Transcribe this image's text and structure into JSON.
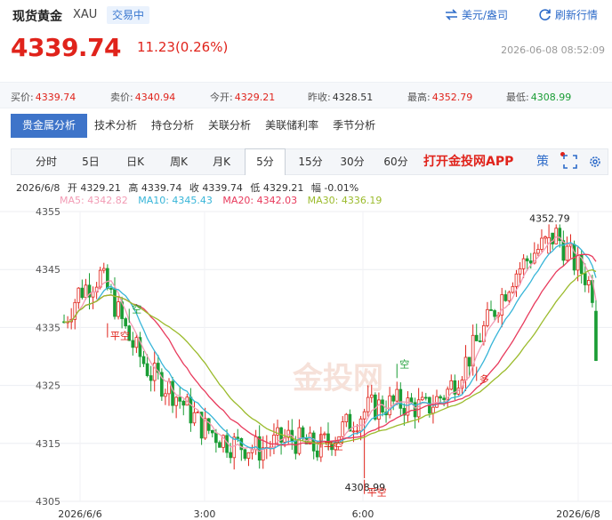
{
  "header": {
    "title": "现货黄金",
    "symbol": "XAU",
    "status": "交易中",
    "unit_link": "美元/盎司",
    "refresh_link": "刷新行情"
  },
  "quote": {
    "price": "4339.74",
    "change": "11.23(0.26%)",
    "timestamp": "2026-06-08 08:52:09"
  },
  "stats": [
    {
      "label": "买价:",
      "value": "4339.74"
    },
    {
      "label": "卖价:",
      "value": "4340.94"
    },
    {
      "label": "今开:",
      "value": "4329.21"
    },
    {
      "label": "昨收:",
      "value": "4328.51"
    },
    {
      "label": "最高:",
      "value": "4352.79"
    },
    {
      "label": "最低:",
      "value": "4308.99"
    }
  ],
  "category_tabs": [
    "贵金属分析",
    "技术分析",
    "持仓分析",
    "关联分析",
    "美联储利率",
    "季节分析"
  ],
  "periods": [
    "分时",
    "5日",
    "日K",
    "周K",
    "月K",
    "5分",
    "15分",
    "30分",
    "60分"
  ],
  "active_period": "5分",
  "app_link": "打开金投网APP",
  "tools": {
    "strategy": "策",
    "fullscreen_icon": "fullscreen-icon",
    "settings_icon": "settings-icon"
  },
  "info_row": {
    "date": "2026/6/8",
    "open": "开 4329.21",
    "high": "高 4339.74",
    "close": "收 4339.74",
    "low": "低 4329.21",
    "range": "幅 -0.01%"
  },
  "ma": [
    {
      "label": "MA5: 4342.82",
      "color": "#f29bb4"
    },
    {
      "label": "MA10: 4345.43",
      "color": "#37b5d8"
    },
    {
      "label": "MA20: 4342.03",
      "color": "#e83a5c"
    },
    {
      "label": "MA30: 4336.19",
      "color": "#9bbb2c"
    }
  ],
  "chart_data": {
    "type": "candlestick",
    "ylim": [
      4305,
      4355
    ],
    "yticks": [
      "4355",
      "4345",
      "4335",
      "4325",
      "4315",
      "4305"
    ],
    "xticks": [
      "2026/6/6",
      "3:00",
      "6:00",
      "2026/6/8"
    ],
    "high_label": "4352.79",
    "low_label": "4308.99",
    "watermark": "金投网",
    "signals": [
      {
        "text": "平空",
        "candle": 12,
        "price": 4334.5
      },
      {
        "text": "空",
        "candle": 18,
        "price": 4337.0
      },
      {
        "text": "平空",
        "candle": 71,
        "price": 4315.5
      },
      {
        "text": "平空",
        "candle": 83,
        "price": 4307.5
      },
      {
        "text": "空",
        "candle": 92,
        "price": 4327.5
      },
      {
        "text": "多",
        "candle": 114,
        "price": 4327.0
      }
    ],
    "ma_colors": [
      "#f29bb4",
      "#37b5d8",
      "#e83a5c",
      "#9bbb2c"
    ],
    "up_color": "#e0231b",
    "down_color": "#1a9d35"
  }
}
